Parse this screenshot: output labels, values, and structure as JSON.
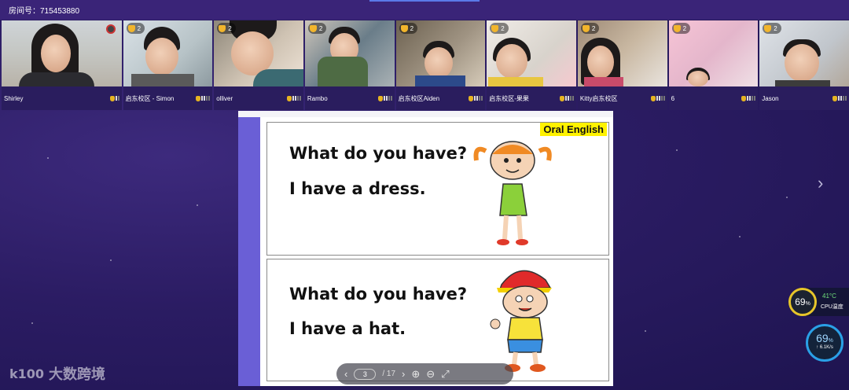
{
  "room": {
    "label": "房间号：715453880"
  },
  "participants": [
    {
      "name": "Shirley",
      "role": "teacher",
      "trophies": ""
    },
    {
      "name": "启东校区 - Simon",
      "trophies": "2"
    },
    {
      "name": "olliver",
      "trophies": "2"
    },
    {
      "name": "Rambo",
      "trophies": "2"
    },
    {
      "name": "启东校区Aiden",
      "trophies": "2"
    },
    {
      "name": "启东校区-果果",
      "trophies": "2"
    },
    {
      "name": "Kitty启东校区",
      "trophies": "2"
    },
    {
      "name": "6",
      "trophies": "2"
    },
    {
      "name": "Jason",
      "trophies": "2"
    }
  ],
  "slide": {
    "badge": "Oral English",
    "card1": {
      "question": "What do you have?",
      "answer": "I have a dress."
    },
    "card2": {
      "question": "What do you have?",
      "answer": "I have a hat."
    }
  },
  "pager": {
    "prev_icon": "‹",
    "current_page": "3",
    "total": "/ 17",
    "next_icon": "›",
    "zoom_in_icon": "⊕",
    "zoom_out_icon": "⊖",
    "fullscreen_icon": "⤢"
  },
  "next_slide_icon": "›",
  "cpu": {
    "usage": "69",
    "unit": "%",
    "temp": "41°C",
    "label": "CPU温度"
  },
  "network": {
    "usage": "69",
    "unit": "%",
    "speed": "↑ 6.1K/s"
  },
  "brand": {
    "logo": "k100",
    "name": "大数跨境"
  }
}
